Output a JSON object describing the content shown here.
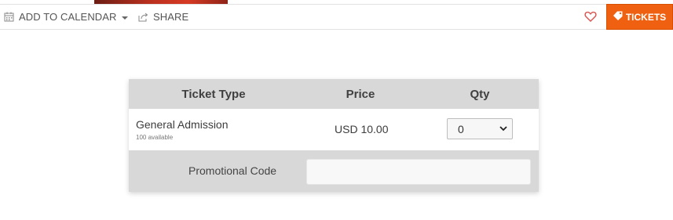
{
  "actionbar": {
    "add_to_calendar": "ADD TO CALENDAR",
    "share": "SHARE",
    "tickets": "TICKETS",
    "accent_color": "#ef6110"
  },
  "table": {
    "headers": {
      "type": "Ticket Type",
      "price": "Price",
      "qty": "Qty"
    },
    "rows": [
      {
        "name": "General Admission",
        "availability": "100 available",
        "price": "USD 10.00",
        "qty_selected": "0"
      }
    ],
    "promo_label": "Promotional Code",
    "promo_value": ""
  },
  "icons": {
    "calendar": "calendar-icon",
    "share": "share-icon",
    "heart": "heart-icon",
    "ticket": "ticket-icon",
    "dropdown": "chevron-down-icon"
  }
}
